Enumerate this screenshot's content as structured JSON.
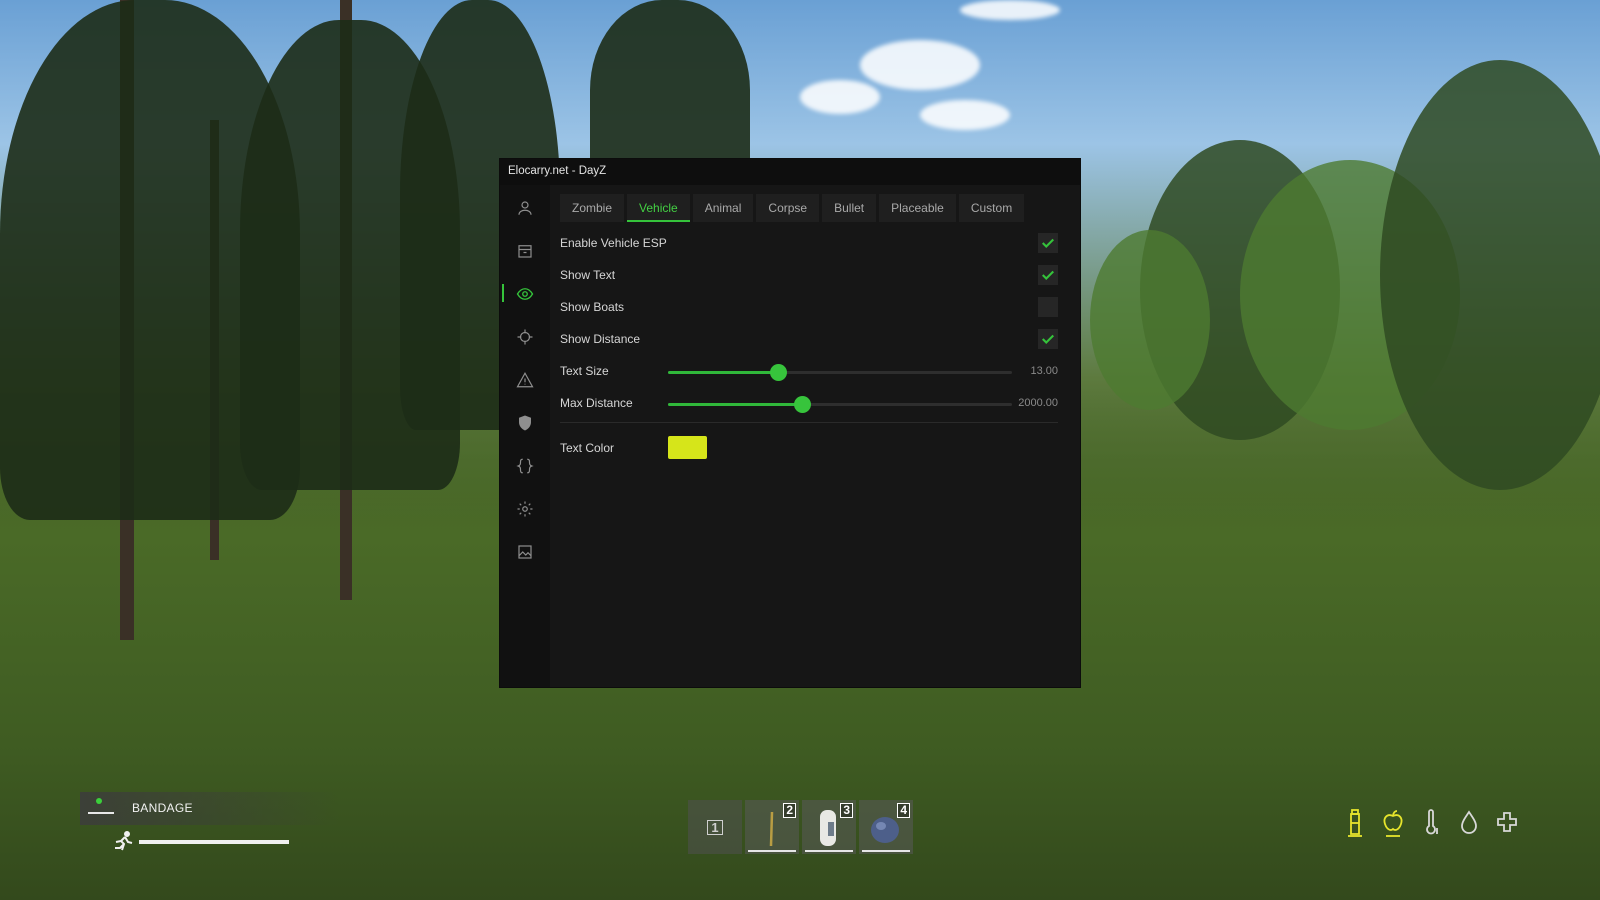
{
  "window": {
    "title": "Elocarry.net - DayZ"
  },
  "sidebar": {
    "items": [
      {
        "name": "player-icon",
        "active": false
      },
      {
        "name": "loot-icon",
        "active": false
      },
      {
        "name": "eye-icon",
        "active": true
      },
      {
        "name": "crosshair-icon",
        "active": false
      },
      {
        "name": "warning-icon",
        "active": false
      },
      {
        "name": "shield-icon",
        "active": false
      },
      {
        "name": "braces-icon",
        "active": false
      },
      {
        "name": "gear-icon",
        "active": false
      },
      {
        "name": "image-icon",
        "active": false
      }
    ]
  },
  "tabs": [
    "Zombie",
    "Vehicle",
    "Animal",
    "Corpse",
    "Bullet",
    "Placeable",
    "Custom"
  ],
  "active_tab": "Vehicle",
  "options": {
    "enable_vehicle_esp": {
      "label": "Enable Vehicle ESP",
      "checked": true
    },
    "show_text": {
      "label": "Show Text",
      "checked": true
    },
    "show_boats": {
      "label": "Show Boats",
      "checked": false
    },
    "show_distance": {
      "label": "Show Distance",
      "checked": true
    }
  },
  "sliders": {
    "text_size": {
      "label": "Text Size",
      "value": "13.00",
      "fraction": 0.32
    },
    "max_distance": {
      "label": "Max Distance",
      "value": "2000.00",
      "fraction": 0.39
    }
  },
  "text_color": {
    "label": "Text Color",
    "value": "#d6e51a"
  },
  "colors": {
    "accent": "#35c33b",
    "panel": "#161616"
  },
  "hud": {
    "status_text": "BANDAGE",
    "stamina_fraction": 1.0,
    "hotbar": [
      {
        "slot": "1",
        "item": "empty"
      },
      {
        "slot": "2",
        "item": "stick"
      },
      {
        "slot": "3",
        "item": "can"
      },
      {
        "slot": "4",
        "item": "stone"
      }
    ],
    "stats": [
      "water-bottle-icon",
      "food-icon",
      "temperature-icon",
      "blood-icon",
      "health-icon"
    ]
  }
}
